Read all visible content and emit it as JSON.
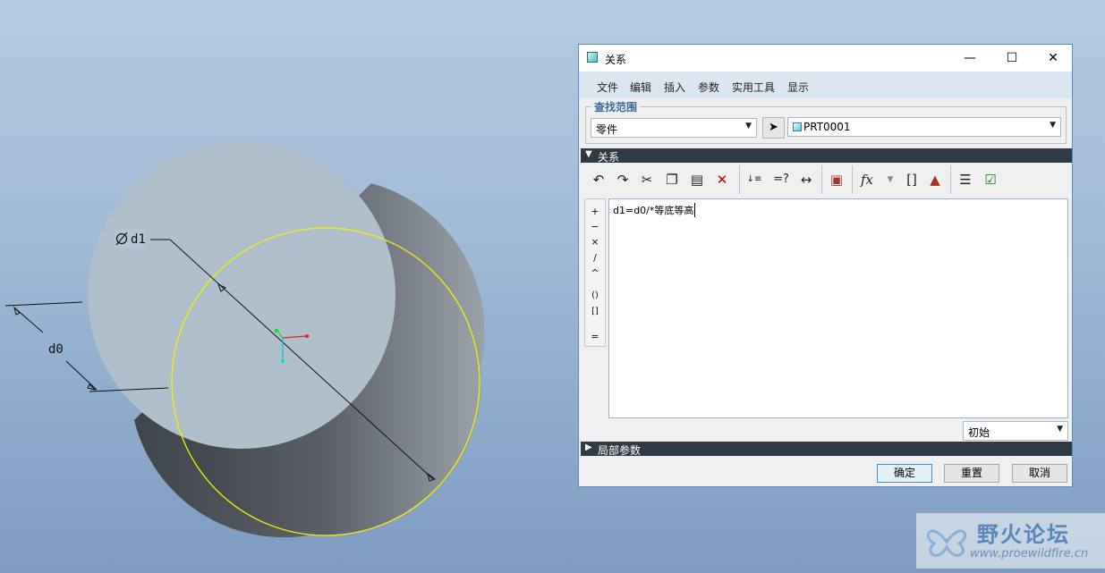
{
  "model": {
    "dim_diameter": "d1",
    "dim_distance": "d0"
  },
  "dialog": {
    "title": "关系",
    "window_controls": {
      "minimize": "—",
      "maximize": "☐",
      "close": "✕"
    },
    "menu": [
      "文件",
      "编辑",
      "插入",
      "参数",
      "实用工具",
      "显示"
    ],
    "lookup": {
      "label": "查找范围",
      "scope_value": "零件",
      "object_value": "PRT0001"
    },
    "relations_section": "关系",
    "toolbar_icons": [
      "undo-icon",
      "redo-icon",
      "cut-icon",
      "copy-icon",
      "paste-icon",
      "delete-icon",
      "sort-relations-icon",
      "evaluate-icon",
      "insert-dimension-icon",
      "lock-parameter-icon",
      "insert-function-icon",
      "insert-parameter-icon",
      "check-units-icon",
      "show-relation-icon",
      "verify-relations-icon"
    ],
    "operators": [
      "+",
      "−",
      "×",
      "/",
      "^",
      "()",
      "[]",
      "="
    ],
    "editor_text": "d1=d0/*等底等高",
    "units_value": "初始",
    "local_params_section": "局部参数",
    "buttons": {
      "ok": "确定",
      "reset": "重置",
      "cancel": "取消"
    }
  },
  "watermark": {
    "title": "野火论坛",
    "url": "www.proewildfire.cn"
  }
}
